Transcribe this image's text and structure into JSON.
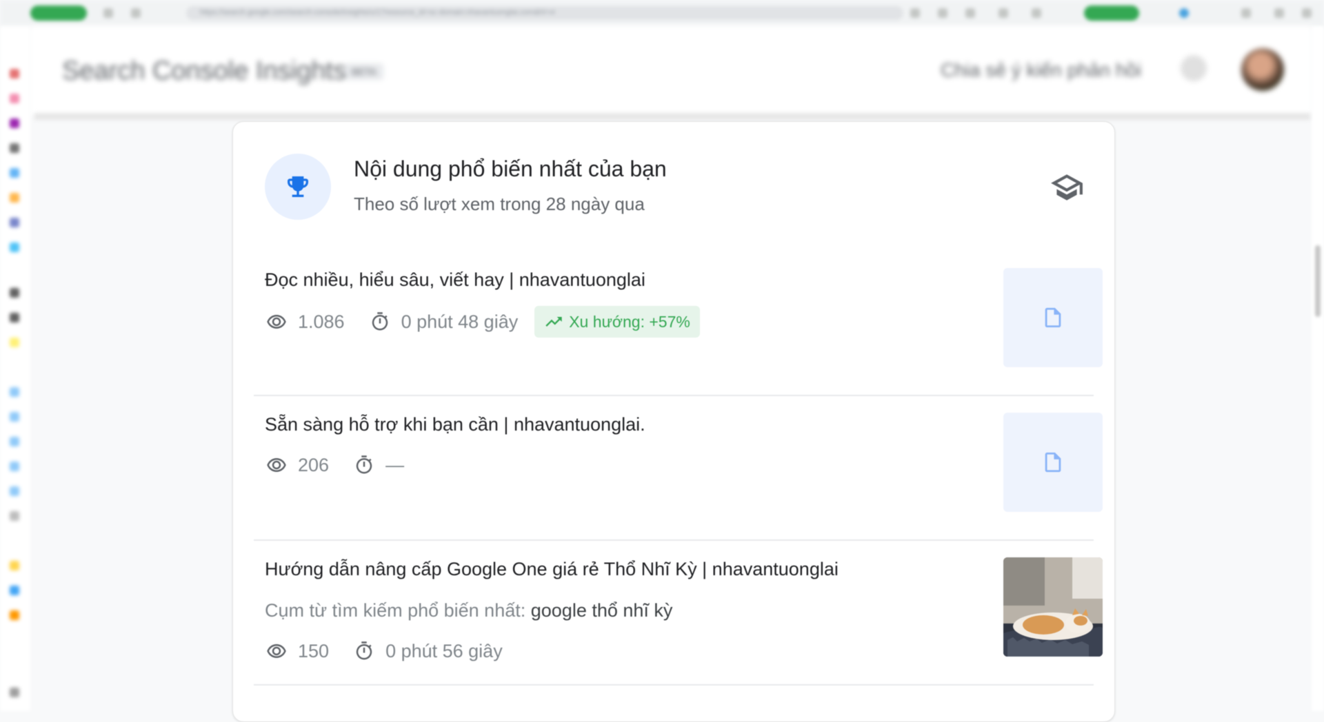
{
  "browser": {
    "url": "https://search.google.com/search-console/insights/u/1?resource_id=sc-domain:nhavantuonglai.com&hl=vi"
  },
  "header": {
    "app_title": "Search Console Insights",
    "beta_label": "BETA",
    "feedback_label": "Chia sẻ ý kiến phản hồi"
  },
  "card": {
    "title": "Nội dung phổ biến nhất của bạn",
    "subtitle": "Theo số lượt xem trong 28 ngày qua",
    "items": [
      {
        "title": "Đọc nhiều, hiểu sâu, viết hay | nhavantuonglai",
        "views": "1.086",
        "duration": "0 phút 48 giây",
        "trend": "Xu hướng: +57%",
        "thumbnail": "document-icon"
      },
      {
        "title": "Sẵn sàng hỗ trợ khi bạn cần | nhavantuonglai.",
        "views": "206",
        "duration": "—",
        "thumbnail": "document-icon"
      },
      {
        "title": "Hướng dẫn nâng cấp Google One giá rẻ Thổ Nhĩ Kỳ | nhavantuonglai",
        "query_label": "Cụm từ tìm kiếm phổ biến nhất: ",
        "query_value": "google thổ nhĩ kỳ",
        "views": "150",
        "duration": "0 phút 56 giây",
        "thumbnail": "cat-photo"
      }
    ]
  },
  "colors": {
    "accent_blue": "#1a73e8",
    "trend_green": "#34a853",
    "trend_bg": "#e6f4ea",
    "icon_bg": "#e8f0fe"
  }
}
